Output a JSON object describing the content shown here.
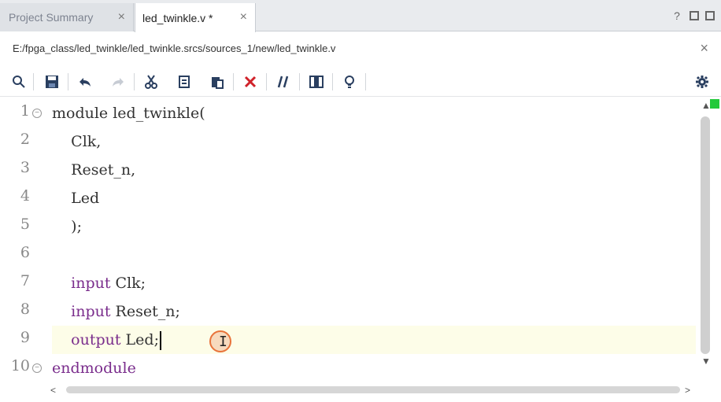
{
  "tabs": [
    {
      "label": "Project Summary",
      "close": "×"
    },
    {
      "label": "led_twinkle.v *",
      "close": "×"
    }
  ],
  "window_buttons": {
    "help": "?",
    "restore": "",
    "max": ""
  },
  "path": {
    "text": "E:/fpga_class/led_twinkle/led_twinkle.srcs/sources_1/new/led_twinkle.v",
    "close": "×"
  },
  "toolbar": {
    "search": "🔍",
    "save": "💾",
    "undo": "↶",
    "redo": "↷",
    "cut": "✂",
    "copy": "⧉",
    "paste": "📋",
    "delete": "✕",
    "comment": "//",
    "columns": "▥",
    "hint": "💡",
    "settings": "⚙"
  },
  "editor": {
    "line_numbers": [
      "1",
      "2",
      "3",
      "4",
      "5",
      "6",
      "7",
      "8",
      "9",
      "10"
    ],
    "lines": [
      {
        "kw": "",
        "text": "module led_twinkle("
      },
      {
        "kw": "",
        "text": "    Clk,"
      },
      {
        "kw": "",
        "text": "    Reset_n,"
      },
      {
        "kw": "",
        "text": "    Led"
      },
      {
        "kw": "",
        "text": "    );"
      },
      {
        "kw": "",
        "text": ""
      },
      {
        "kw": "    input",
        "text": " Clk;"
      },
      {
        "kw": "    input",
        "text": " Reset_n;"
      },
      {
        "kw": "    output",
        "text": " Led;"
      },
      {
        "kw": "endmodule",
        "text": ""
      }
    ]
  },
  "scroll": {
    "up": "▲",
    "down": "▼",
    "left": "<",
    "right": ">"
  }
}
